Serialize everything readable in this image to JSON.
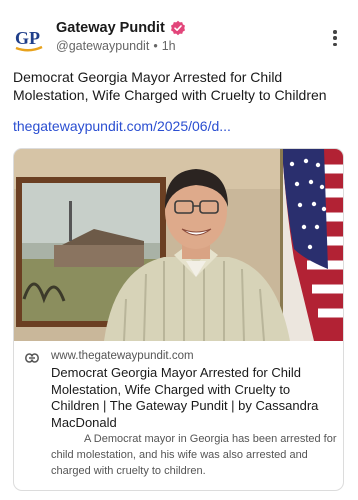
{
  "account": {
    "name": "Gateway Pundit",
    "handle": "@gatewaypundit",
    "separator": "•",
    "time": "1h",
    "avatar_icon": "gateway-pundit-logo",
    "avatar_text": "GP",
    "verified_icon": "verified-badge-icon"
  },
  "colors": {
    "brand_blue": "#1f3e8a",
    "logo_orange": "#e8a21c",
    "verified_pink": "#e2457a",
    "link_blue": "#2b4fd1"
  },
  "post": {
    "text": "Democrat Georgia Mayor Arrested for Child Molestation, Wife Charged with Cruelty to Children",
    "link_text": "thegatewaypundit.com/2025/06/d..."
  },
  "card": {
    "domain": "www.thegatewaypundit.com",
    "title": "Democrat Georgia Mayor Arrested for Child Molestation, Wife Charged with Cruelty to Children | The Gateway Pundit | by Cassandra MacDonald",
    "description": "A Democrat mayor in Georgia has been arrested for child molestation, and his wife was also arrested and charged with cruelty to children.",
    "link_icon": "link-icon"
  },
  "menu": {
    "icon": "more-vertical-icon"
  }
}
